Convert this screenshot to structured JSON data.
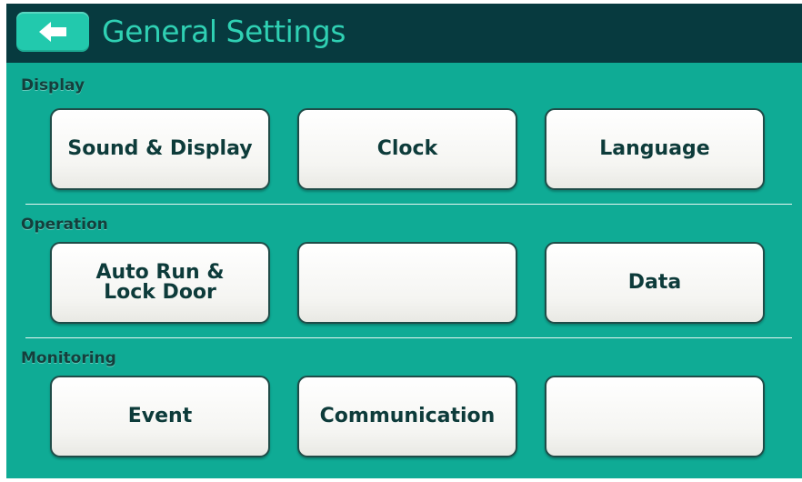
{
  "header": {
    "title": "General Settings",
    "back_icon": "arrow-left-icon"
  },
  "colors": {
    "background": "#0fab95",
    "header_background": "#073a3f",
    "title_color": "#2fd0b3",
    "back_button": "#22c9ad",
    "button_text": "#0d3b3a"
  },
  "sections": [
    {
      "label": "Display",
      "buttons": [
        "Sound & Display",
        "Clock",
        "Language"
      ]
    },
    {
      "label": "Operation",
      "buttons": [
        "Auto Run &\nLock Door",
        "",
        "Data"
      ]
    },
    {
      "label": "Monitoring",
      "buttons": [
        "Event",
        "Communication",
        ""
      ]
    }
  ]
}
